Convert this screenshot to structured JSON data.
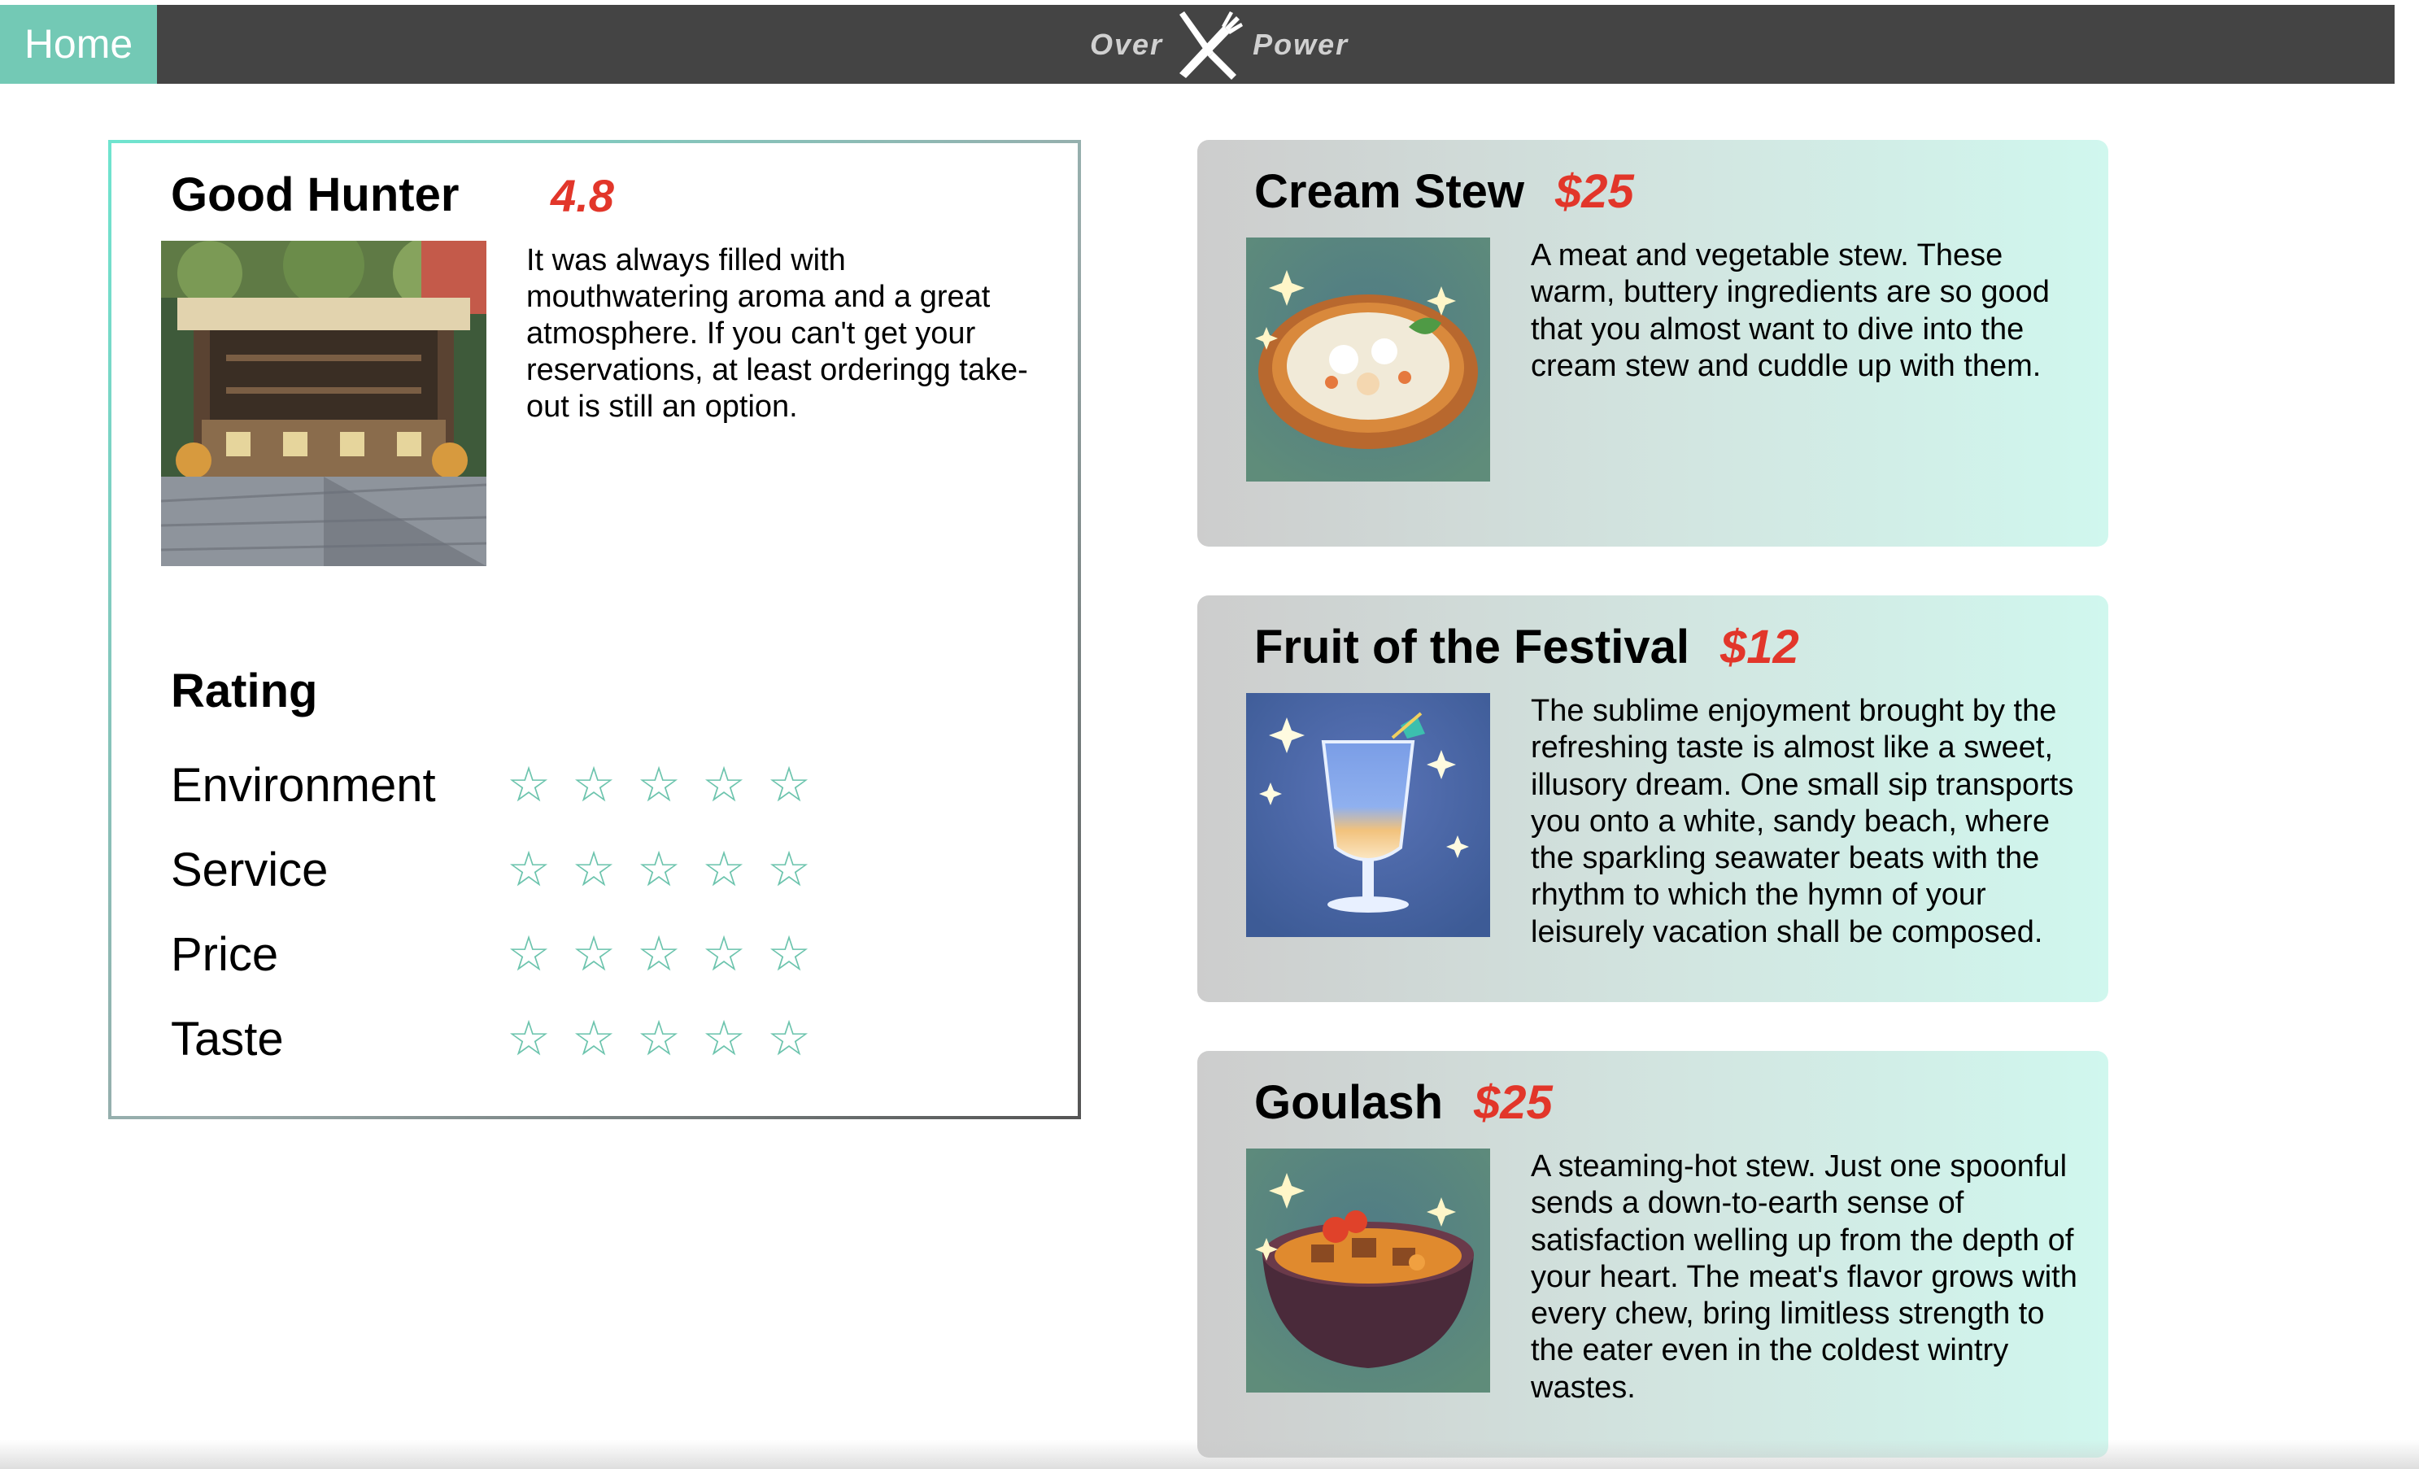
{
  "nav": {
    "home_label": "Home",
    "logo_left": "Over",
    "logo_right": "Power",
    "bar_color": "#444444",
    "home_color": "#73c9b5"
  },
  "restaurant": {
    "name": "Good Hunter",
    "score": "4.8",
    "description": "It was always filled with mouthwatering aroma and a great atmosphere. If you can't get your reservations, at least orderingg take-out is still an option.",
    "image_icon": "food-stall-image",
    "rating_title": "Rating",
    "ratings": [
      {
        "label": "Environment",
        "stars": 0,
        "max": 5
      },
      {
        "label": "Service",
        "stars": 0,
        "max": 5
      },
      {
        "label": "Price",
        "stars": 0,
        "max": 5
      },
      {
        "label": "Taste",
        "stars": 0,
        "max": 5
      }
    ],
    "star_glyph": "☆",
    "star_color": "#6cc4ad",
    "score_color": "#e2362a"
  },
  "dishes": [
    {
      "name": "Cream Stew",
      "price": "$25",
      "image_icon": "cream-stew-image",
      "description": "A meat and vegetable stew. These warm, buttery ingredients are so good that you almost want to dive into the cream stew and cuddle up with them."
    },
    {
      "name": "Fruit of the Festival",
      "price": "$12",
      "image_icon": "fruit-drink-image",
      "description": "The sublime enjoyment brought by the refreshing taste is almost like a sweet, illusory dream. One small sip transports you onto a white, sandy beach, where the sparkling seawater beats with the rhythm to which the hymn of your leisurely vacation shall be composed."
    },
    {
      "name": "Goulash",
      "price": "$25",
      "image_icon": "goulash-image",
      "description": "A steaming-hot stew. Just one spoonful sends a down-to-earth sense of satisfaction welling up from the depth of your heart. The meat's flavor grows with every chew, bring limitless strength to the eater even in the coldest wintry wastes."
    }
  ]
}
